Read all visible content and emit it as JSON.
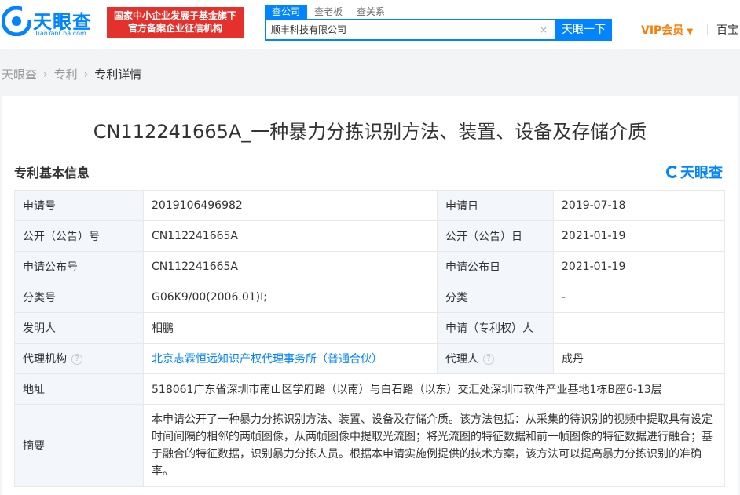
{
  "header": {
    "logo_text": "天眼查",
    "logo_sub": "TianYanCha.com",
    "banner_line1": "国家中小企业发展子基金旗下",
    "banner_line2": "官方备案企业征信机构",
    "search_tabs": [
      "查公司",
      "查老板",
      "查关系"
    ],
    "search_value": "顺丰科技有限公司",
    "search_button": "天眼一下",
    "vip_label": "VIP会员",
    "baibao": "百宝"
  },
  "breadcrumb": [
    "天眼查",
    "专利",
    "专利详情"
  ],
  "patent": {
    "title": "CN112241665A_一种暴力分拣识别方法、装置、设备及存储介质",
    "section_title": "专利基本信息",
    "watermark": "天眼查",
    "rows": [
      {
        "l1": "申请号",
        "v1": "2019106496982",
        "l2": "申请日",
        "v2": "2019-07-18"
      },
      {
        "l1": "公开（公告）号",
        "v1": "CN112241665A",
        "l2": "公开（公告）日",
        "v2": "2021-01-19"
      },
      {
        "l1": "申请公布号",
        "v1": "CN112241665A",
        "l2": "申请公布日",
        "v2": "2021-01-19"
      },
      {
        "l1": "分类号",
        "v1": "G06K9/00(2006.01)I;",
        "l2": "分类",
        "v2": "-"
      },
      {
        "l1": "发明人",
        "v1": "相鹏",
        "l2": "申请（专利权）人",
        "v2": ""
      },
      {
        "l1": "代理机构",
        "v1": "北京志霖恒远知识产权代理事务所（普通合伙）",
        "l2": "代理人",
        "v2": "成丹"
      }
    ],
    "address_label": "地址",
    "address": "518061广东省深圳市南山区学府路（以南）与白石路（以东）交汇处深圳市软件产业基地1栋B座6-13层",
    "abstract_label": "摘要",
    "abstract": "本申请公开了一种暴力分拣识别方法、装置、设备及存储介质。该方法包括：从采集的待识别的视频中提取具有设定时间间隔的相邻的两帧图像，从两帧图像中提取光流图；将光流图的特征数据和前一帧图像的特征数据进行融合；基于融合的特征数据，识别暴力分拣人员。根据本申请实施例提供的技术方案，该方法可以提高暴力分拣识别的准确率。"
  },
  "colors": {
    "brand": "#0084ff",
    "banner": "#e5312c",
    "vip": "#ff7a00"
  }
}
